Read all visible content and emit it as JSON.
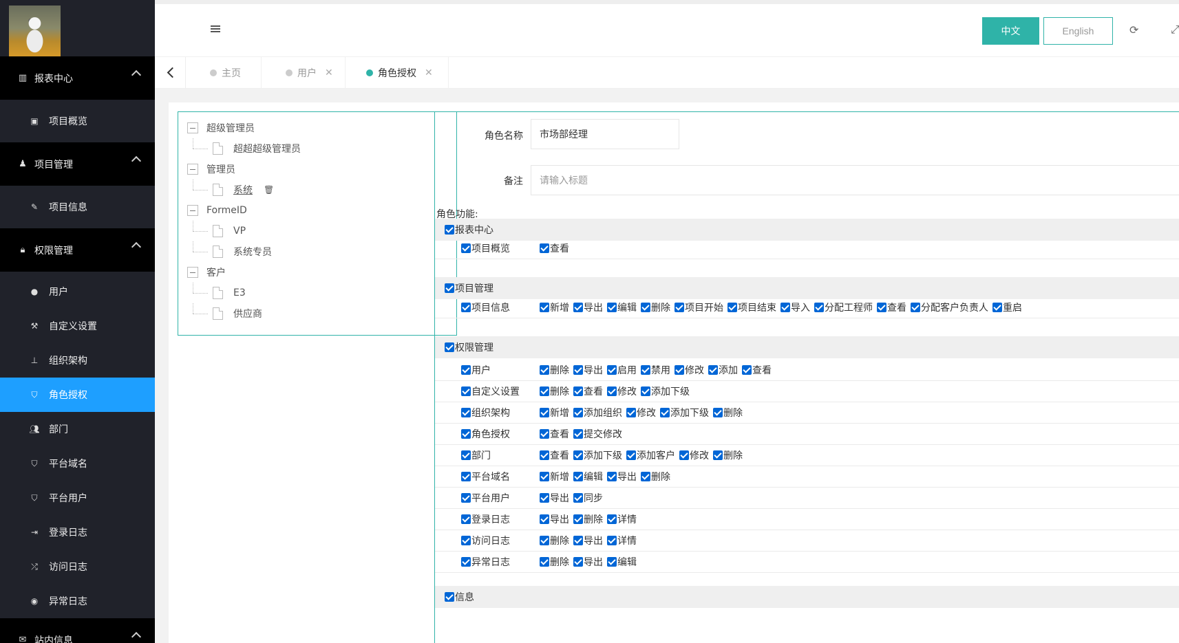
{
  "sidebar": {
    "groups": [
      {
        "label": "报表中心",
        "icon": "bar-chart-icon",
        "items": [
          {
            "label": "项目概览",
            "icon": "image-icon"
          }
        ]
      },
      {
        "label": "项目管理",
        "icon": "user-tie-icon",
        "items": [
          {
            "label": "项目信息",
            "icon": "pencil-icon"
          }
        ]
      },
      {
        "label": "权限管理",
        "icon": "lock-icon",
        "items": [
          {
            "label": "用户",
            "icon": "user-icon"
          },
          {
            "label": "自定义设置",
            "icon": "wrench-icon"
          },
          {
            "label": "组织架构",
            "icon": "sitemap-icon"
          },
          {
            "label": "角色授权",
            "icon": "shield-icon",
            "active": true
          },
          {
            "label": "部门",
            "icon": "users-icon"
          },
          {
            "label": "平台域名",
            "icon": "shield-icon"
          },
          {
            "label": "平台用户",
            "icon": "shield-icon"
          },
          {
            "label": "登录日志",
            "icon": "sign-in-icon"
          },
          {
            "label": "访问日志",
            "icon": "random-icon"
          },
          {
            "label": "异常日志",
            "icon": "dot-circle-icon"
          }
        ]
      },
      {
        "label": "站内信息",
        "icon": "envelope-icon"
      }
    ]
  },
  "header": {
    "lang_zh": "中文",
    "lang_en": "English",
    "accent_color": "#2fb3a8"
  },
  "tabs": [
    {
      "label": "主页",
      "closable": false
    },
    {
      "label": "用户",
      "closable": true
    },
    {
      "label": "角色授权",
      "closable": true,
      "active": true
    }
  ],
  "tree": [
    {
      "label": "超级管理员",
      "children": [
        {
          "label": "超超超级管理员"
        }
      ]
    },
    {
      "label": "管理员",
      "children": [
        {
          "label": "系统",
          "selected": true
        }
      ]
    },
    {
      "label": "FormeID",
      "children": [
        {
          "label": "VP"
        },
        {
          "label": "系统专员"
        }
      ]
    },
    {
      "label": "客户",
      "children": [
        {
          "label": "E3"
        },
        {
          "label": "供应商"
        }
      ]
    }
  ],
  "form": {
    "role_name_label": "角色名称",
    "role_name_value": "市场部经理",
    "remark_label": "备注",
    "remark_placeholder": "请输入标题",
    "permissions_title": "角色功能:"
  },
  "permissions": [
    {
      "section": "报表中心",
      "rows": [
        {
          "name": "项目概览",
          "actions": [
            "查看"
          ]
        }
      ]
    },
    {
      "section": "项目管理",
      "rows": [
        {
          "name": "项目信息",
          "actions": [
            "新增",
            "导出",
            "编辑",
            "删除",
            "项目开始",
            "项目结束",
            "导入",
            "分配工程师",
            "查看",
            "分配客户负责人",
            "重启"
          ]
        }
      ]
    },
    {
      "section": "权限管理",
      "rows": [
        {
          "name": "用户",
          "actions": [
            "删除",
            "导出",
            "启用",
            "禁用",
            "修改",
            "添加",
            "查看"
          ]
        },
        {
          "name": "自定义设置",
          "actions": [
            "删除",
            "查看",
            "修改",
            "添加下级"
          ]
        },
        {
          "name": "组织架构",
          "actions": [
            "新增",
            "添加组织",
            "修改",
            "添加下级",
            "删除"
          ]
        },
        {
          "name": "角色授权",
          "actions": [
            "查看",
            "提交修改"
          ]
        },
        {
          "name": "部门",
          "actions": [
            "查看",
            "添加下级",
            "添加客户",
            "修改",
            "删除"
          ]
        },
        {
          "name": "平台域名",
          "actions": [
            "新增",
            "编辑",
            "导出",
            "删除"
          ]
        },
        {
          "name": "平台用户",
          "actions": [
            "导出",
            "同步"
          ]
        },
        {
          "name": "登录日志",
          "actions": [
            "导出",
            "删除",
            "详情"
          ]
        },
        {
          "name": "访问日志",
          "actions": [
            "删除",
            "导出",
            "详情"
          ]
        },
        {
          "name": "异常日志",
          "actions": [
            "删除",
            "导出",
            "编辑"
          ]
        }
      ]
    },
    {
      "section": "信息",
      "rows": []
    }
  ]
}
